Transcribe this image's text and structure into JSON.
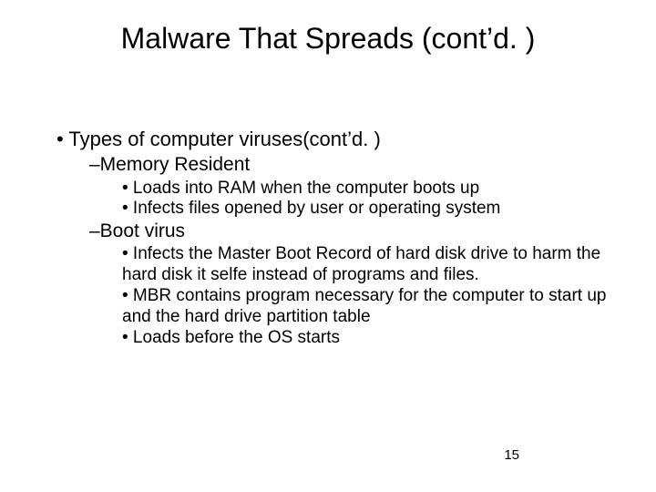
{
  "title": "Malware That Spreads (cont’d. )",
  "body": {
    "l1_types": "• Types of computer viruses(cont’d. )",
    "l2_memres": "–Memory Resident",
    "l3_memres_a": "• Loads into RAM when the computer boots up",
    "l3_memres_b": "• Infects files opened by user or operating system",
    "l2_boot": "–Boot virus",
    "l3_boot_a": "• Infects the Master Boot Record of hard disk drive to harm the hard disk it selfe instead of programs and files.",
    "l3_boot_b": "• MBR contains program necessary for the computer to start up and the hard drive partition table",
    "l3_boot_c": "• Loads before the OS starts"
  },
  "page_number": "15"
}
